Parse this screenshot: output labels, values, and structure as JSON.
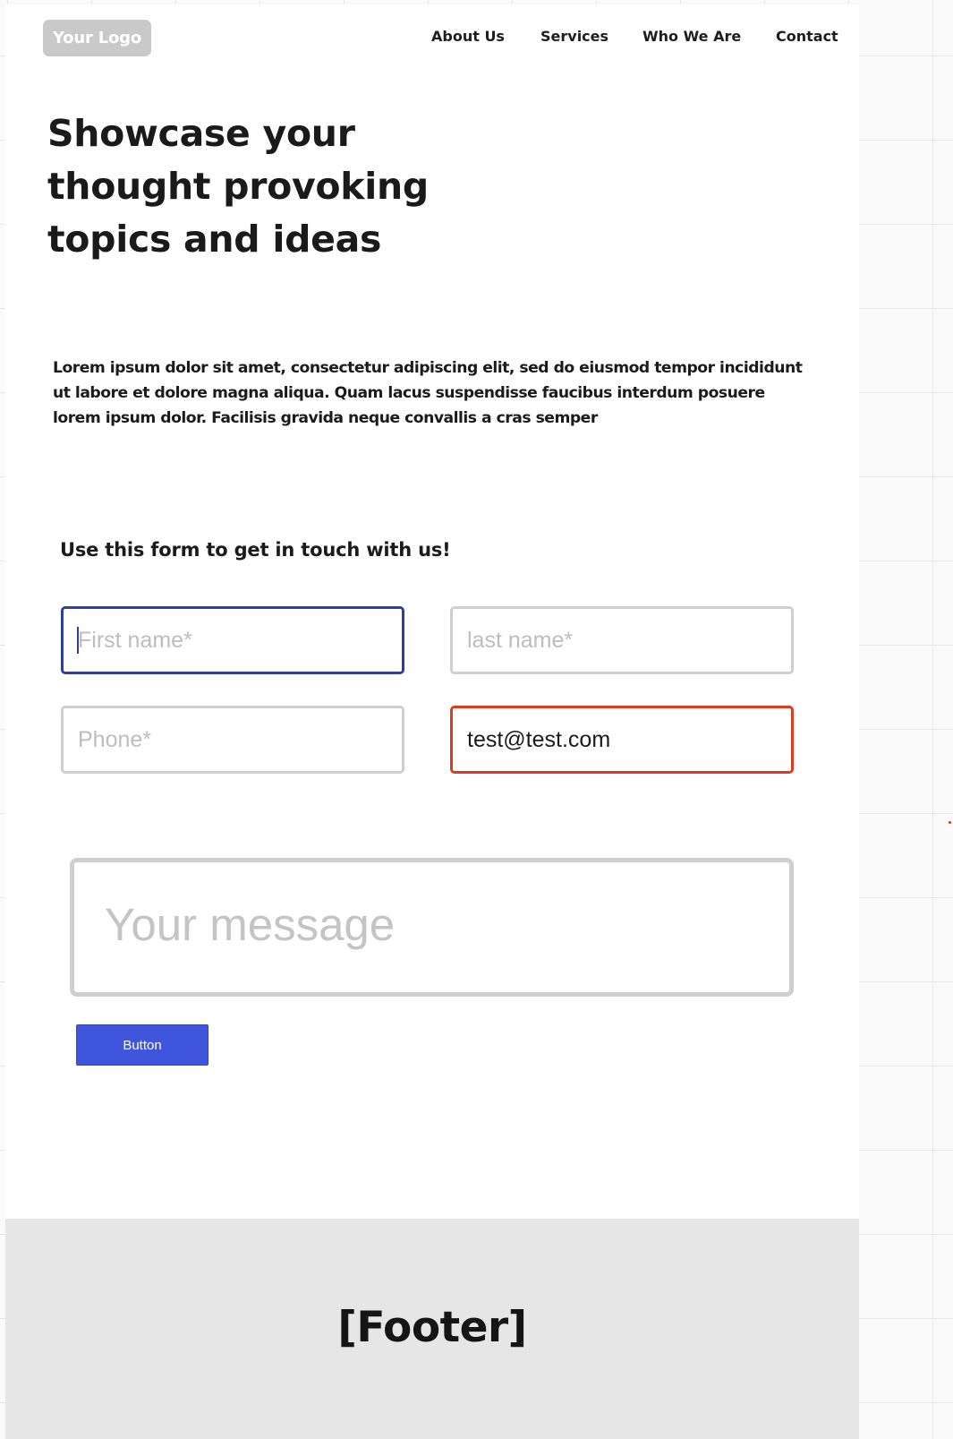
{
  "header": {
    "logo_text": "Your Logo",
    "nav": [
      {
        "label": "About Us"
      },
      {
        "label": "Services"
      },
      {
        "label": "Who We Are"
      },
      {
        "label": "Contact"
      }
    ]
  },
  "hero": {
    "title": "Showcase your thought provoking topics and ideas",
    "body": "Lorem ipsum dolor sit amet, consectetur adipiscing elit, sed do eiusmod tempor incididunt ut labore et dolore magna aliqua. Quam lacus suspendisse faucibus interdum posuere lorem ipsum dolor. Facilisis gravida neque convallis a cras semper"
  },
  "form": {
    "heading": "Use this form to get in touch with us!",
    "first_name": {
      "placeholder": "First name*",
      "value": "",
      "state": "focused"
    },
    "last_name": {
      "placeholder": "last name*",
      "value": ""
    },
    "phone": {
      "placeholder": "Phone*",
      "value": ""
    },
    "email": {
      "placeholder": "",
      "value": "test@test.com",
      "state": "error"
    },
    "message": {
      "placeholder": "Your message",
      "value": ""
    },
    "submit_label": "Button"
  },
  "footer": {
    "label": "[Footer]"
  },
  "colors": {
    "focus_border": "#2f3f9e",
    "error_border": "#e03a1e",
    "button_bg": "#3f55dc",
    "logo_bg": "#c9c9c9",
    "footer_bg": "#e6e6e6"
  }
}
